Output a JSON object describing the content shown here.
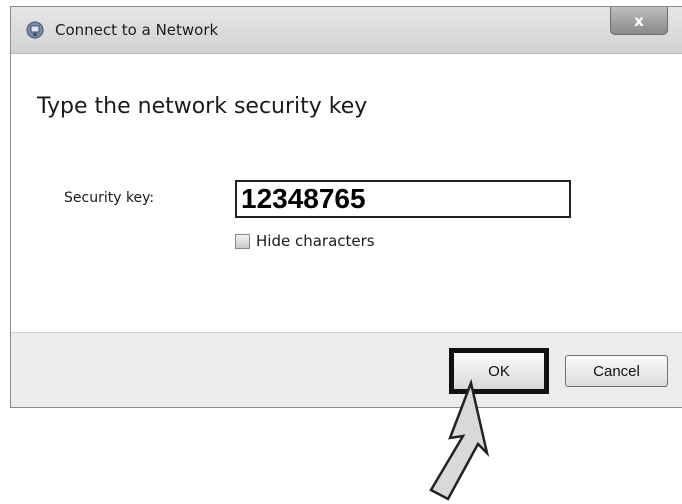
{
  "window": {
    "title": "Connect to a Network",
    "close_label": "x"
  },
  "content": {
    "heading": "Type the network security key",
    "security_key_label": "Security key:",
    "security_key_value": "12348765",
    "hide_characters_label": "Hide characters",
    "hide_characters_checked": false
  },
  "footer": {
    "ok_label": "OK",
    "cancel_label": "Cancel"
  },
  "icons": {
    "title_icon": "network-icon",
    "pointer": "arrow-pointer-icon"
  }
}
